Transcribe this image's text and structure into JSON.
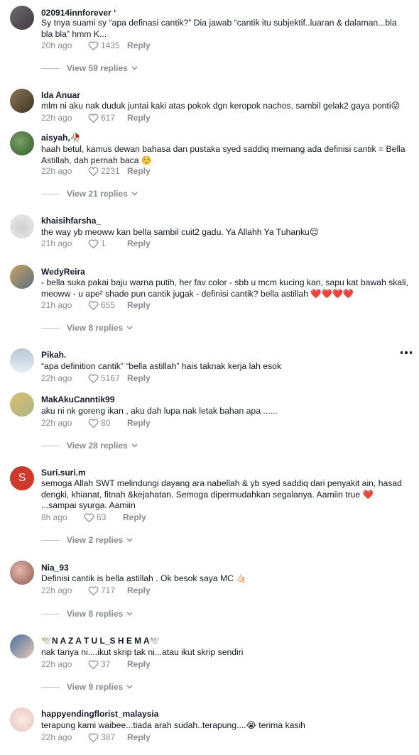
{
  "comments": [
    {
      "username": "020914innforever ʻ",
      "text": "Sy tnya suami sy “apa definasi cantik?” Dia jawab “cantik itu subjektif..luaran & dalaman...bla bla bla” hmm K...",
      "time": "20h ago",
      "likes": "1435",
      "reply": "Reply",
      "view_replies": "View 59 replies"
    },
    {
      "username": "Ida Anuar",
      "text": "mlm ni aku nak duduk juntai kaki atas pokok dgn keropok nachos, sambil gelak2 gaya ponti😜",
      "time": "22h ago",
      "likes": "617",
      "reply": "Reply"
    },
    {
      "username": "aisyah,🥀",
      "text": "haah betul, kamus dewan bahasa dan pustaka syed saddiq memang ada definisi cantik = Bella Astillah, dah pernah baca ☺️",
      "time": "22h ago",
      "likes": "2231",
      "reply": "Reply",
      "view_replies": "View 21 replies"
    },
    {
      "username": "khaisihfarsha_",
      "text": "the way yb meoww kan bella sambil cuit2 gadu. Ya Allahh Ya Tuhanku😌",
      "time": "21h ago",
      "likes": "1",
      "reply": "Reply"
    },
    {
      "username": "WedyReira",
      "text": "- bella suka pakai baju warna putih, her fav color - sbb u mcm kucing kan, sapu kat bawah skali, meoww - u ape² shade pun cantik jugak - definisi cantik? bella astillah ❤️❤️❤️❤️",
      "time": "21h ago",
      "likes": "655",
      "reply": "Reply",
      "view_replies": "View 8 replies"
    },
    {
      "username": "Pikah.",
      "text": "“apa definition cantik” “bella astillah” hais taknak kerja lah esok",
      "time": "22h ago",
      "likes": "5167",
      "reply": "Reply"
    },
    {
      "username": "MakAkuCanntik99",
      "text": "aku ni nk goreng ikan , aku dah lupa nak letak bahan apa ......",
      "time": "22h ago",
      "likes": "80",
      "reply": "Reply",
      "view_replies": "View 28 replies"
    },
    {
      "username": "Suri.suri.m",
      "avatar_letter": "S",
      "text": "semoga Allah SWT melindungi dayang ara nabellah & yb syed saddiq dari penyakit ain, hasad dengki, khianat, fitnah &kejahatan. Semoga dipermudahkan segalanya. Aamiin true ❤️ ...sampai syurga. Aamiin",
      "time": "8h ago",
      "likes": "63",
      "reply": "Reply",
      "view_replies": "View 2 replies"
    },
    {
      "username": "Nia_93",
      "text": "Definisi cantik is bella astillah . Ok besok saya MC 🤙🏻",
      "time": "22h ago",
      "likes": "717",
      "reply": "Reply",
      "view_replies": "View 8 replies"
    },
    {
      "username": "🕊️N A Z A T U L_S H E M A🕊️",
      "text": "nak tanya ni....ikut skrip tak ni...atau ikut skrip sendiri",
      "time": "22h ago",
      "likes": "37",
      "reply": "Reply",
      "view_replies": "View 9 replies"
    },
    {
      "username": "happyendingflorist_malaysia",
      "text": "terapung kami waibee...tiada arah sudah..terapung....😭 terima kasih",
      "time": "22h ago",
      "likes": "387",
      "reply": "Reply"
    }
  ],
  "colors": {
    "text": "#161823",
    "muted": "#8a8b91",
    "accent_avatar": "#d0382a"
  }
}
